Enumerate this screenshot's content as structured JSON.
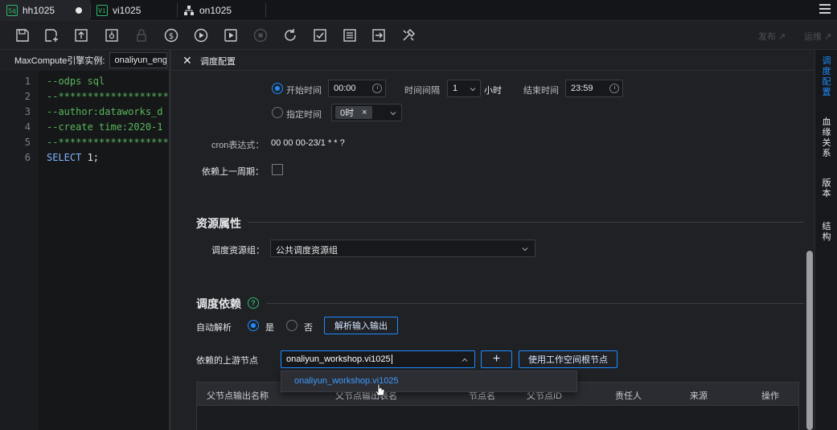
{
  "tabs": [
    {
      "label": "hh1025",
      "icon": "sql-file-icon",
      "icon_text": "Sq"
    },
    {
      "label": "vi1025",
      "icon": "vi-file-icon",
      "icon_text": "Vi"
    },
    {
      "label": "on1025",
      "icon": "node-tree-icon"
    }
  ],
  "toolbar": {
    "publish_label": "发布 ↗",
    "ops_label": "运维 ↗"
  },
  "engine": {
    "label": "MaxCompute引擎实例:",
    "value": "onaliyun_eng"
  },
  "code": {
    "lines": [
      {
        "num": "1",
        "text": "--odps sql"
      },
      {
        "num": "2",
        "text": "--**********************"
      },
      {
        "num": "3",
        "text": "--author:dataworks_d"
      },
      {
        "num": "4",
        "text": "--create time:2020-1"
      },
      {
        "num": "5",
        "text": "--**********************"
      },
      {
        "num": "6",
        "kw": "SELECT",
        "rest": " 1;"
      }
    ]
  },
  "panel": {
    "title": "调度配置",
    "schedule": {
      "start_time_label": "开始时间",
      "start_time_value": "00:00",
      "interval_label": "时间间隔",
      "interval_value": "1",
      "interval_unit": "小时",
      "end_time_label": "结束时间",
      "end_time_value": "23:59",
      "specified_time_label": "指定时间",
      "specified_tag": "0时",
      "tag_close": "×",
      "cron_label": "cron表达式：",
      "cron_value": "00 00 00-23/1 * * ?",
      "depend_prev_label": "依赖上一周期："
    },
    "resource": {
      "section_title": "资源属性",
      "group_label": "调度资源组：",
      "group_value": "公共调度资源组"
    },
    "dependency": {
      "section_title": "调度依赖",
      "help": "?",
      "auto_parse_label": "自动解析",
      "yes_label": "是",
      "no_label": "否",
      "parse_button": "解析输入输出",
      "upstream_label": "依赖的上游节点",
      "upstream_value": "onaliyun_workshop.vi1025",
      "add_label": "+",
      "root_button": "使用工作空间根节点",
      "suggestion": "onaliyun_workshop.vi1025",
      "table_headers": [
        "父节点输出名称",
        "父节点输出表名",
        "节点名",
        "父节点ID",
        "责任人",
        "来源",
        "操作"
      ]
    }
  },
  "rightbar": {
    "items": [
      {
        "label": "调度配置",
        "chars": [
          "调",
          "度",
          "配",
          "置"
        ],
        "active": true
      },
      {
        "label": "血缘关系",
        "chars": [
          "血",
          "缘",
          "关",
          "系"
        ],
        "active": false
      },
      {
        "label": "版本",
        "chars": [
          "版",
          "本"
        ],
        "active": false
      },
      {
        "label": "结构",
        "chars": [
          "结",
          "构"
        ],
        "active": false
      }
    ]
  },
  "colors": {
    "accent": "#1f8bff",
    "comment": "#58b65c",
    "background": "#1f2125"
  }
}
